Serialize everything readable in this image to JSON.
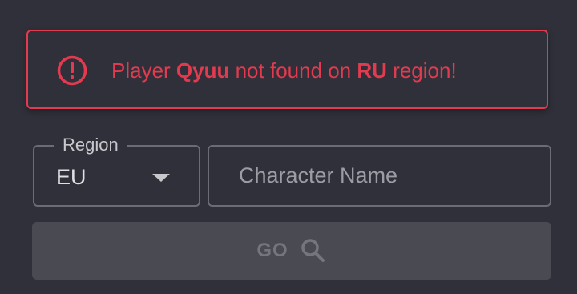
{
  "alert": {
    "prefix": "Player ",
    "player": "Qyuu",
    "middle": " not found on ",
    "region": "RU",
    "suffix": " region!",
    "icon": "alert-circle-icon",
    "color": "#e23a4f"
  },
  "form": {
    "region_label": "Region",
    "region_value": "EU",
    "name_placeholder": "Character Name",
    "name_value": ""
  },
  "go_button": {
    "label": "GO",
    "icon": "search-icon"
  }
}
